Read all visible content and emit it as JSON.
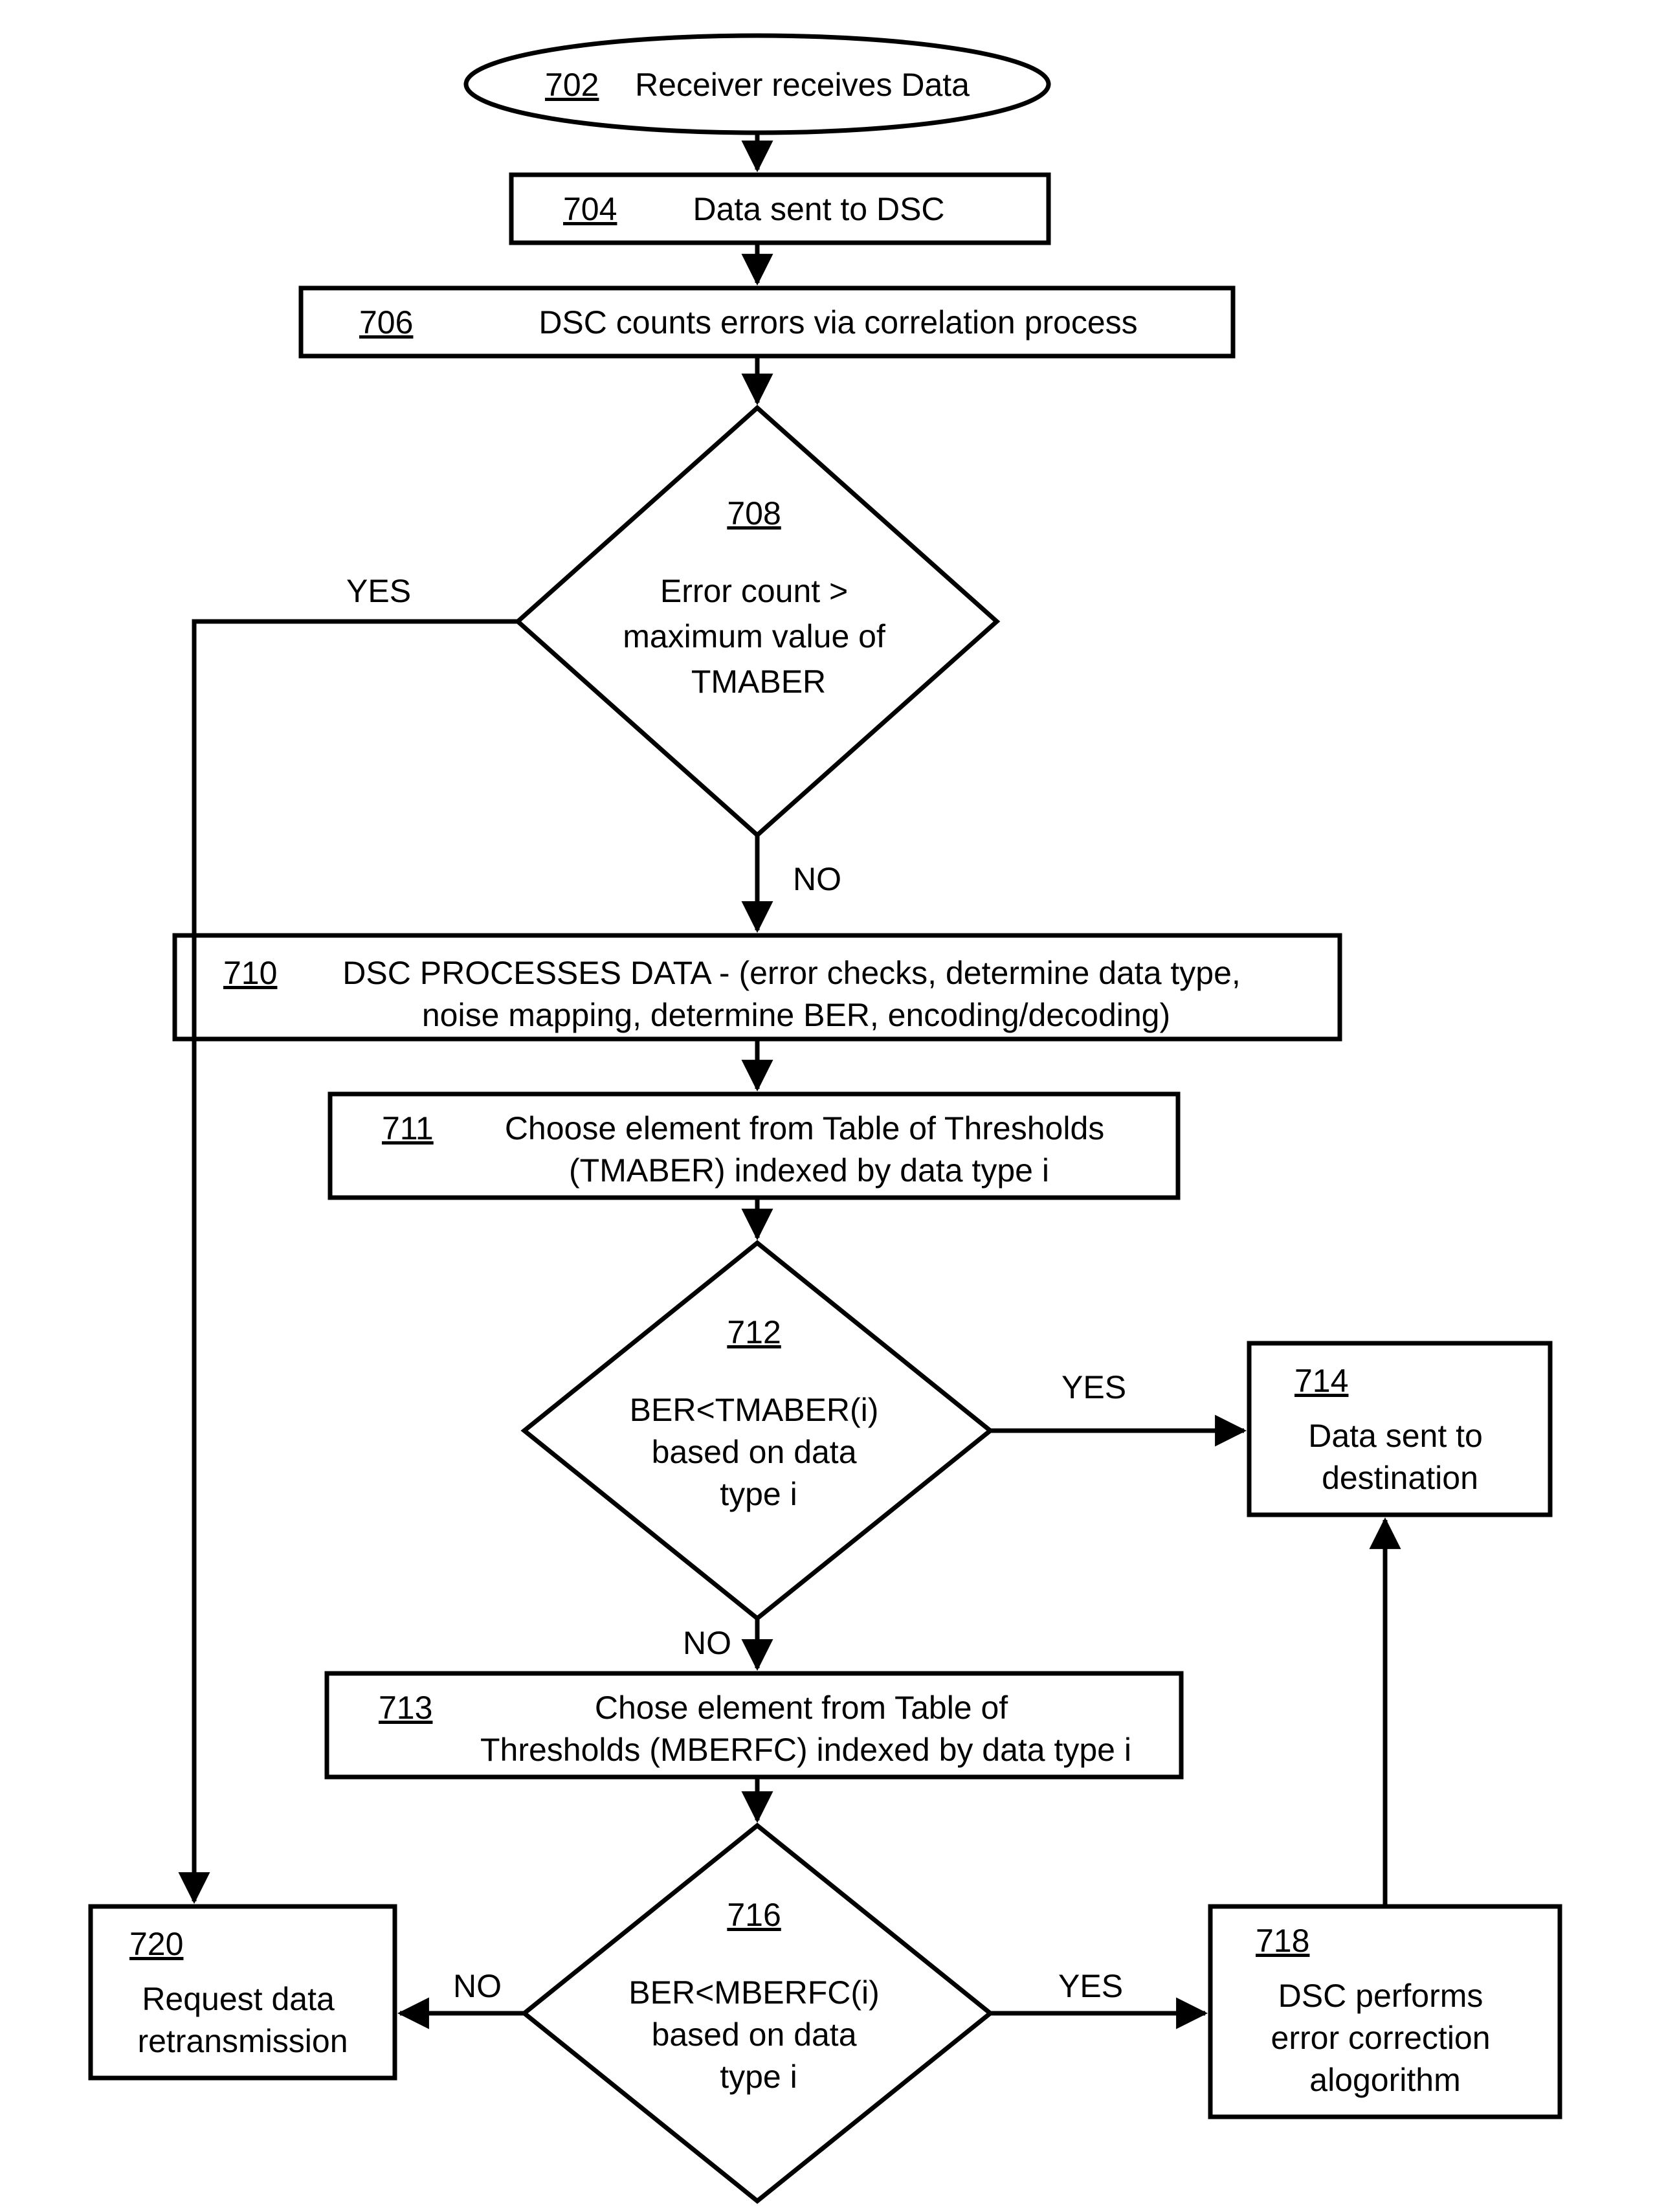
{
  "nodes": {
    "n702": {
      "ref": "702",
      "text": "Receiver receives Data"
    },
    "n704": {
      "ref": "704",
      "text": "Data sent to DSC"
    },
    "n706": {
      "ref": "706",
      "text": "DSC counts errors via correlation process"
    },
    "n708": {
      "ref": "708",
      "text": "Error count > maximum value of TMABER"
    },
    "n710": {
      "ref": "710",
      "text": "DSC PROCESSES DATA - (error checks, determine data type, noise mapping, determine BER, encoding/decoding)"
    },
    "n711": {
      "ref": "711",
      "text": "Choose element from Table of Thresholds (TMABER) indexed by data type i"
    },
    "n712": {
      "ref": "712",
      "text": "BER<TMABER(i) based on data type i"
    },
    "n713": {
      "ref": "713",
      "text": "Chose element from Table of Thresholds (MBERFC) indexed by data type i"
    },
    "n714": {
      "ref": "714",
      "text": "Data sent to destination"
    },
    "n716": {
      "ref": "716",
      "text": "BER<MBERFC(i) based on data type i"
    },
    "n718": {
      "ref": "718",
      "text": "DSC performs error correction alogorithm"
    },
    "n720": {
      "ref": "720",
      "text": "Request data retransmission"
    }
  },
  "edges": {
    "e708_yes": "YES",
    "e708_no": "NO",
    "e712_yes": "YES",
    "e712_no": "NO",
    "e716_yes": "YES",
    "e716_no": "NO"
  }
}
